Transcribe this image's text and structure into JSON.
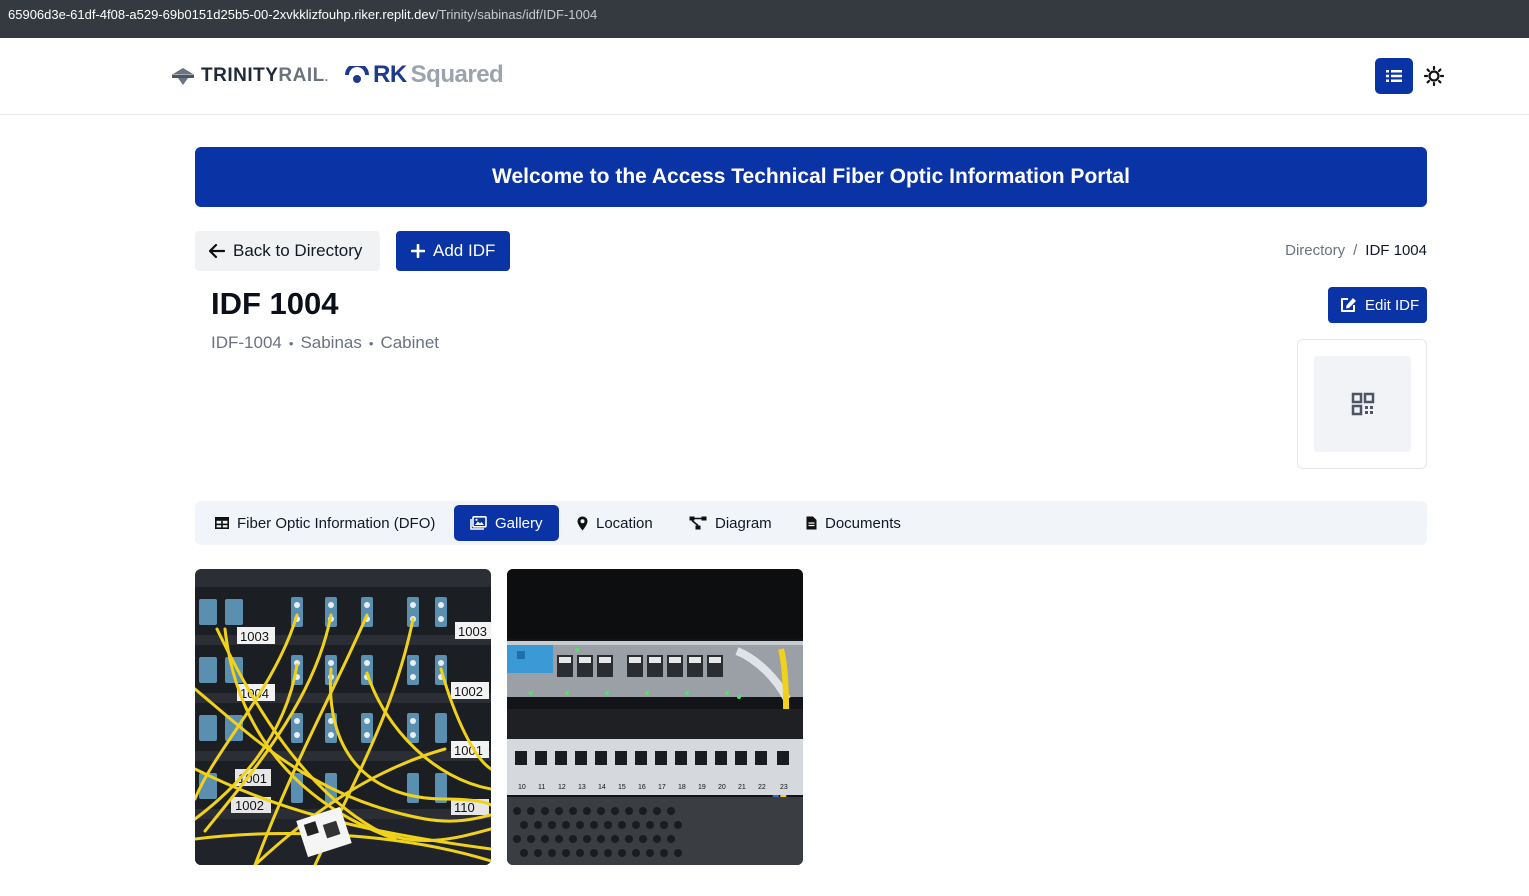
{
  "browser": {
    "url_host": "65906d3e-61df-4f08-a529-69b0151d25b5-00-2xvkklizfouhp.riker.replit.dev",
    "url_path": "/Trinity/sabinas/idf/IDF-1004"
  },
  "header": {
    "logo_trinity_main": "TRINITY",
    "logo_trinity_rail": "RAIL",
    "logo_rk_main": "RK",
    "logo_rk_squared": "Squared",
    "menu_icon": "list-icon",
    "theme_icon": "sun-icon"
  },
  "banner": {
    "text": "Welcome to the Access Technical Fiber Optic Information Portal"
  },
  "actions": {
    "back_label": "Back to Directory",
    "add_label": "Add IDF",
    "edit_label": "Edit IDF"
  },
  "breadcrumb": {
    "root": "Directory",
    "separator": "/",
    "current": "IDF 1004"
  },
  "idf": {
    "title": "IDF 1004",
    "code": "IDF-1004",
    "site": "Sabinas",
    "type": "Cabinet",
    "separator": "•"
  },
  "tabs": [
    {
      "label": "Fiber Optic Information (DFO)",
      "icon": "table-icon"
    },
    {
      "label": "Gallery",
      "icon": "images-icon"
    },
    {
      "label": "Location",
      "icon": "map-pin-icon"
    },
    {
      "label": "Diagram",
      "icon": "diagram-icon"
    },
    {
      "label": "Documents",
      "icon": "file-icon"
    }
  ],
  "active_tab": "Gallery",
  "gallery": {
    "photo1": {
      "labels": [
        "1003",
        "1004",
        "1002",
        "1001",
        "1003",
        "1002",
        "1001",
        "110"
      ]
    },
    "photo2": {
      "port_numbers": [
        "10",
        "11",
        "12",
        "13",
        "14",
        "15",
        "16",
        "17",
        "18",
        "19",
        "20",
        "21",
        "22",
        "23"
      ]
    }
  },
  "colors": {
    "primary": "#0a33a5",
    "tab_bg": "#f1f4f8",
    "muted_text": "#6b7280"
  }
}
